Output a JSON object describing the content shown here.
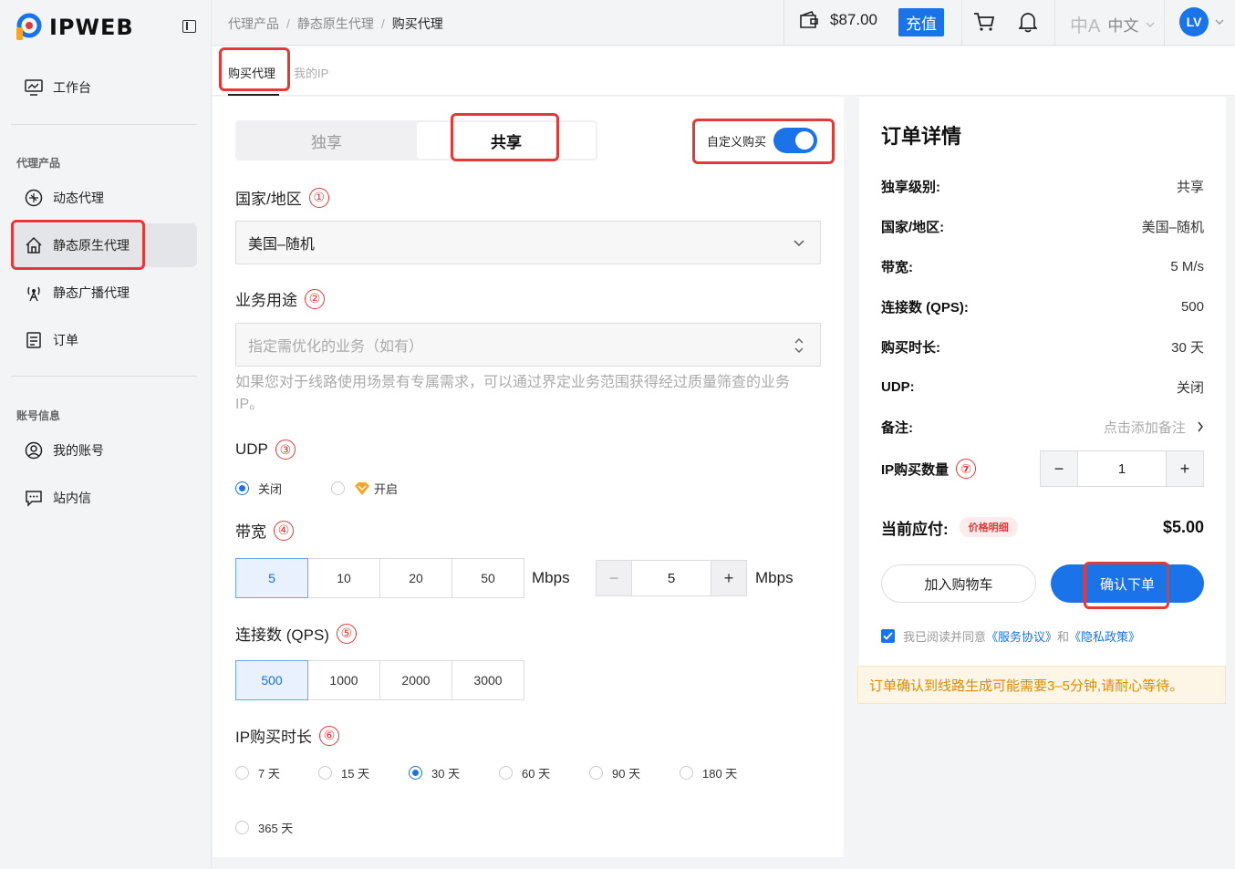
{
  "app": {
    "brand": "IPWEB"
  },
  "sidebar": {
    "workbench": "工作台",
    "section_proxy": "代理产品",
    "dynamic": "动态代理",
    "static_native": "静态原生代理",
    "static_broadcast": "静态广播代理",
    "orders": "订单",
    "section_account": "账号信息",
    "my_account": "我的账号",
    "inbox": "站内信"
  },
  "topbar": {
    "breadcrumb": [
      "代理产品",
      "静态原生代理",
      "购买代理"
    ],
    "balance": "$87.00",
    "recharge": "充值",
    "language": "中文",
    "avatar": "LV"
  },
  "tabs": {
    "buy": "购买代理",
    "my_ip": "我的IP"
  },
  "form": {
    "mode_exclusive": "独享",
    "mode_shared": "共享",
    "custom_buy": "自定义购买",
    "country_label": "国家/地区",
    "country_num": "①",
    "country_value": "美国–随机",
    "usage_label": "业务用途",
    "usage_num": "②",
    "usage_placeholder": "指定需优化的业务（如有）",
    "usage_hint": "如果您对于线路使用场景有专属需求，可以通过界定业务范围获得经过质量筛查的业务 IP。",
    "udp_label": "UDP",
    "udp_num": "③",
    "udp_off": "关闭",
    "udp_on": "开启",
    "bw_label": "带宽",
    "bw_num": "④",
    "bw_options": [
      "5",
      "10",
      "20",
      "50"
    ],
    "bw_unit": "Mbps",
    "bw_custom": "5",
    "bw_minus": "−",
    "bw_plus": "+",
    "qps_label": "连接数 (QPS)",
    "qps_num": "⑤",
    "qps_options": [
      "500",
      "1000",
      "2000",
      "3000"
    ],
    "dur_label": "IP购买时长",
    "dur_num": "⑥",
    "durations": [
      "7 天",
      "15 天",
      "30 天",
      "60 天",
      "90 天",
      "180 天",
      "365 天"
    ]
  },
  "order": {
    "title": "订单详情",
    "level_k": "独享级别:",
    "level_v": "共享",
    "country_k": "国家/地区:",
    "country_v": "美国–随机",
    "bw_k": "带宽:",
    "bw_v": "5 M/s",
    "qps_k": "连接数 (QPS):",
    "qps_v": "500",
    "dur_k": "购买时长:",
    "dur_v": "30 天",
    "udp_k": "UDP:",
    "udp_v": "关闭",
    "note_k": "备注:",
    "note_v": "点击添加备注",
    "qty_k": "IP购买数量",
    "qty_num": "⑦",
    "qty_v": "1",
    "qty_minus": "−",
    "qty_plus": "+",
    "pay_k": "当前应付:",
    "price_detail": "价格明细",
    "pay_v": "$5.00",
    "add_cart": "加入购物车",
    "confirm": "确认下单",
    "agree_pre": "我已阅读并同意",
    "terms": "《服务协议》",
    "and": "和",
    "privacy": "《隐私政策》",
    "notice": "订单确认到线路生成可能需要3–5分钟,请耐心等待。"
  },
  "colors": {
    "accent": "#1a73e8",
    "highlight": "#e53935",
    "notice": "#e08a00"
  }
}
